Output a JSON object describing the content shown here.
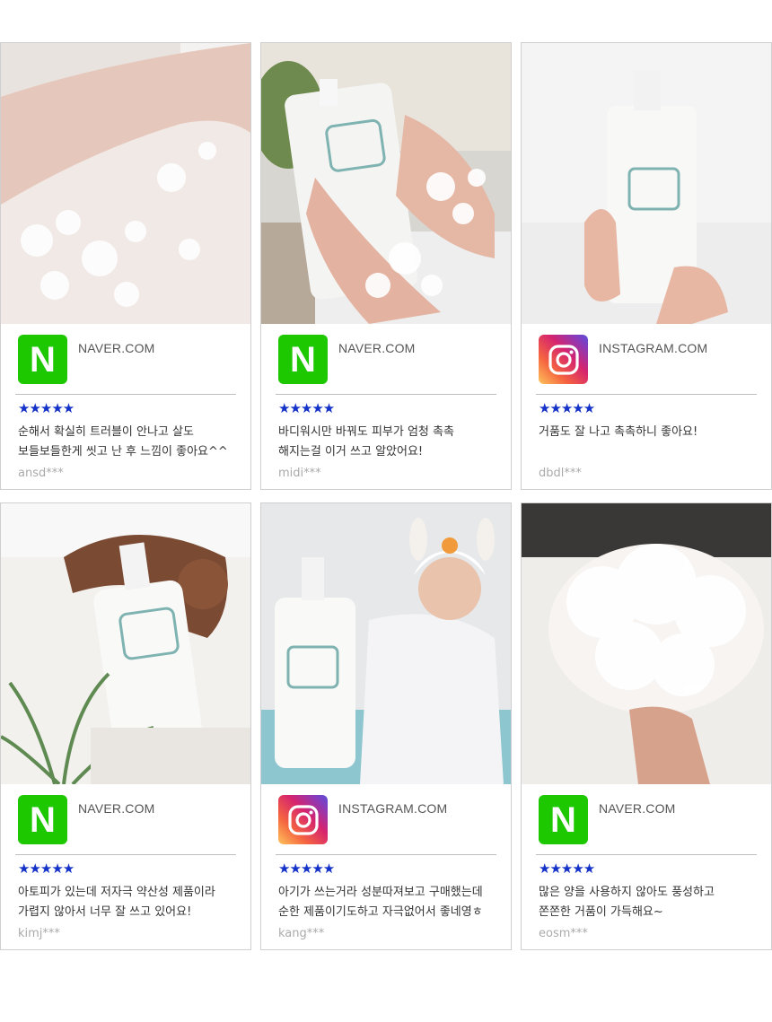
{
  "colors": {
    "naver": "#1ec800",
    "stars": "#1432c8",
    "border": "#cfcfcf"
  },
  "reviews": [
    {
      "photo": "arm-foam-photo",
      "source_icon": "naver-icon",
      "source": "NAVER.COM",
      "stars": "★★★★★",
      "text": "순해서 확실히 트러블이 안나고 살도\n보들보들한게 씻고 난 후 느낌이 좋아요^^",
      "user": "ansd***"
    },
    {
      "photo": "hands-bottle-photo",
      "source_icon": "naver-icon",
      "source": "NAVER.COM",
      "stars": "★★★★★",
      "text": "바디워시만 바꿔도 피부가 엄청 촉촉\n해지는걸 이거 쓰고 알았어요!",
      "user": "midi***"
    },
    {
      "photo": "held-bottle-photo",
      "source_icon": "instagram-icon",
      "source": "INSTAGRAM.COM",
      "stars": "★★★★★",
      "text": "거품도 잘 나고 촉촉하니 좋아요!",
      "user": "dbdl***"
    },
    {
      "photo": "bottle-teddy-photo",
      "source_icon": "naver-icon",
      "source": "NAVER.COM",
      "stars": "★★★★★",
      "text": "아토피가 있는데 저자극 약산성 제품이라\n가렵지 않아서 너무 잘 쓰고 있어요!",
      "user": "kimj***"
    },
    {
      "photo": "baby-bath-photo",
      "source_icon": "instagram-icon",
      "source": "INSTAGRAM.COM",
      "stars": "★★★★★",
      "text": "아기가 쓰는거라 성분따져보고 구매했는데\n순한 제품이기도하고 자극없어서 좋네영ㅎ",
      "user": "kang***"
    },
    {
      "photo": "foam-hand-photo",
      "source_icon": "naver-icon",
      "source": "NAVER.COM",
      "stars": "★★★★★",
      "text": "많은 양을 사용하지 않아도 풍성하고\n쫀쫀한 거품이 가득해요~",
      "user": "eosm***"
    }
  ]
}
